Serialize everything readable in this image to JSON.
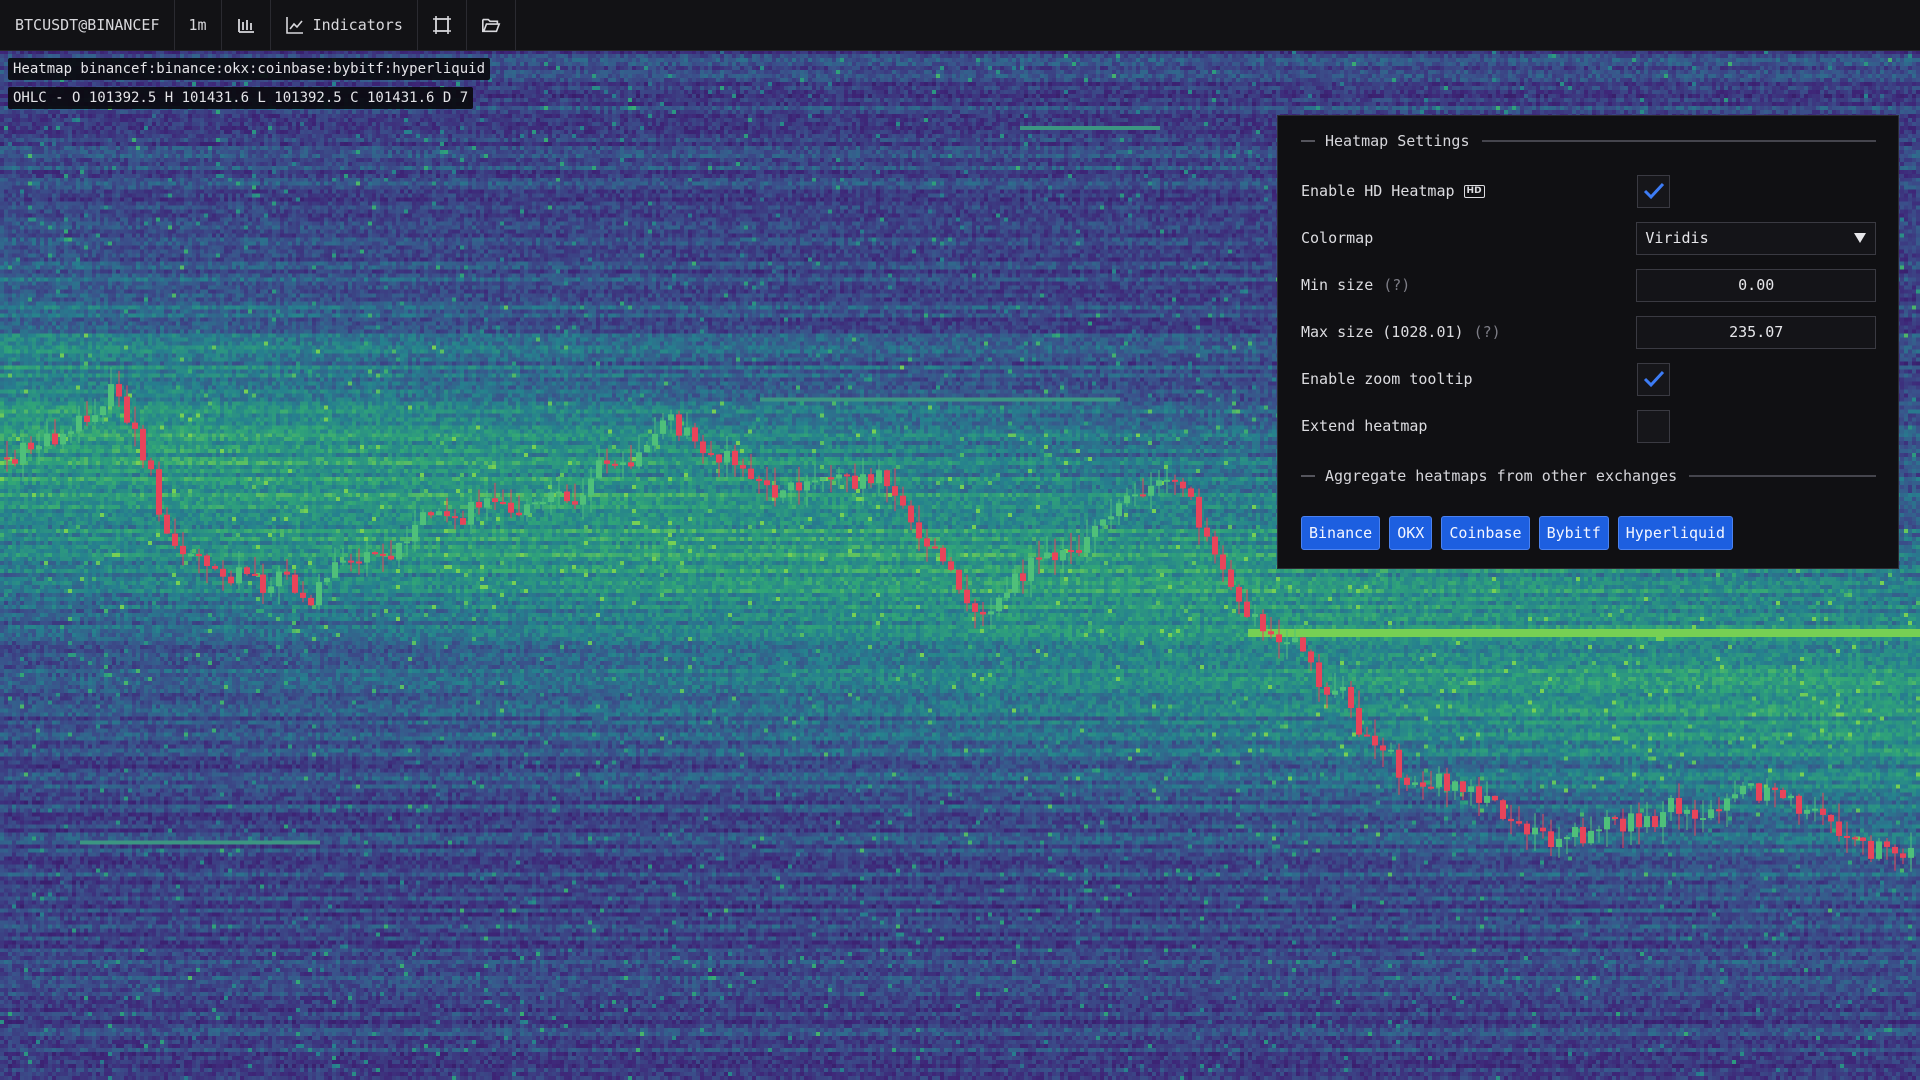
{
  "toolbar": {
    "symbol": "BTCUSDT@BINANCEF",
    "timeframe": "1m",
    "indicators_label": "Indicators"
  },
  "info": {
    "heatmap_line": "Heatmap binancef:binance:okx:coinbase:bybitf:hyperliquid",
    "ohlc_line": "OHLC - O 101392.5 H 101431.6 L 101392.5 C 101431.6 D 7"
  },
  "settings": {
    "title": "Heatmap Settings",
    "enable_hd_label": "Enable HD Heatmap",
    "hd_badge": "HD",
    "enable_hd_checked": true,
    "colormap_label": "Colormap",
    "colormap_value": "Viridis",
    "min_size_label": "Min size",
    "min_size_hint": "(?)",
    "min_size_value": "0.00",
    "max_size_label": "Max size (1028.01)",
    "max_size_hint": "(?)",
    "max_size_value": "235.07",
    "zoom_tooltip_label": "Enable zoom tooltip",
    "zoom_tooltip_checked": true,
    "extend_label": "Extend heatmap",
    "extend_checked": false,
    "aggregate_title": "Aggregate heatmaps from other exchanges",
    "exchanges": [
      "Binance",
      "OKX",
      "Coinbase",
      "Bybitf",
      "Hyperliquid"
    ]
  },
  "colors": {
    "accent": "#1d5fe0",
    "candle_up": "#4fc07a",
    "candle_down": "#e8445a",
    "heat_low": "#3b1a5e",
    "heat_high": "#7fe060"
  },
  "icons": {
    "chart_type": "candle-bars-icon",
    "indicators": "line-chart-icon",
    "layout": "crop-frame-icon",
    "open": "folder-open-icon",
    "checkmark": "check-icon",
    "dropdown": "triangle-down-icon"
  }
}
